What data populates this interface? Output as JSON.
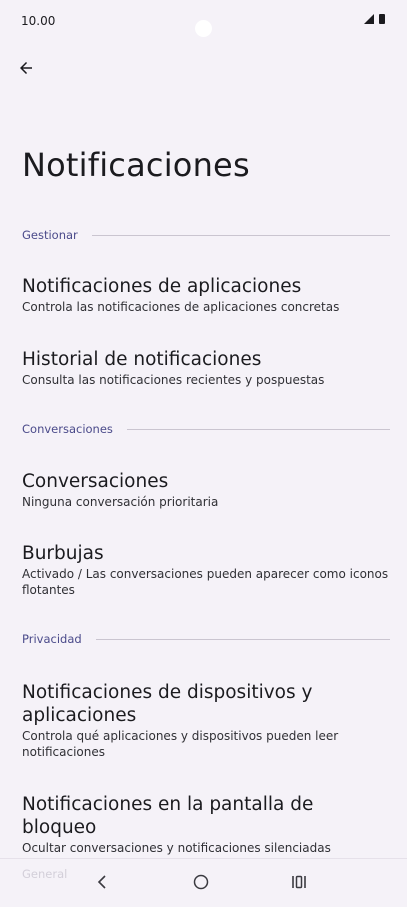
{
  "status_bar": {
    "time": "10.00",
    "icons": [
      "signal-icon",
      "battery-icon"
    ]
  },
  "header": {
    "back_icon": "arrow-left-icon",
    "title": "Notificaciones"
  },
  "sections": [
    {
      "label": "Gestionar",
      "items": [
        {
          "title": "Notificaciones de aplicaciones",
          "summary": "Controla las notificaciones de aplicaciones concretas"
        },
        {
          "title": "Historial de notificaciones",
          "summary": "Consulta las notificaciones recientes y pospuestas"
        }
      ]
    },
    {
      "label": "Conversaciones",
      "items": [
        {
          "title": "Conversaciones",
          "summary": "Ninguna conversación prioritaria"
        },
        {
          "title": "Burbujas",
          "summary": "Activado / Las conversaciones pueden aparecer como iconos flotantes"
        }
      ]
    },
    {
      "label": "Privacidad",
      "items": [
        {
          "title": "Notificaciones de dispositivos y aplicaciones",
          "summary": "Controla qué aplicaciones y dispositivos pueden leer notificaciones"
        },
        {
          "title": "Notificaciones en la pantalla de bloqueo",
          "summary": "Ocultar conversaciones y notificaciones silenciadas"
        }
      ]
    },
    {
      "label": "General"
    }
  ],
  "nav_bar": {
    "icons": [
      "nav-back-icon",
      "nav-home-icon",
      "nav-recents-icon"
    ]
  },
  "colors": {
    "background": "#f5f2f8",
    "section_label": "#4a4a8a",
    "divider": "#cac5d0",
    "text": "#1b1b1f"
  }
}
